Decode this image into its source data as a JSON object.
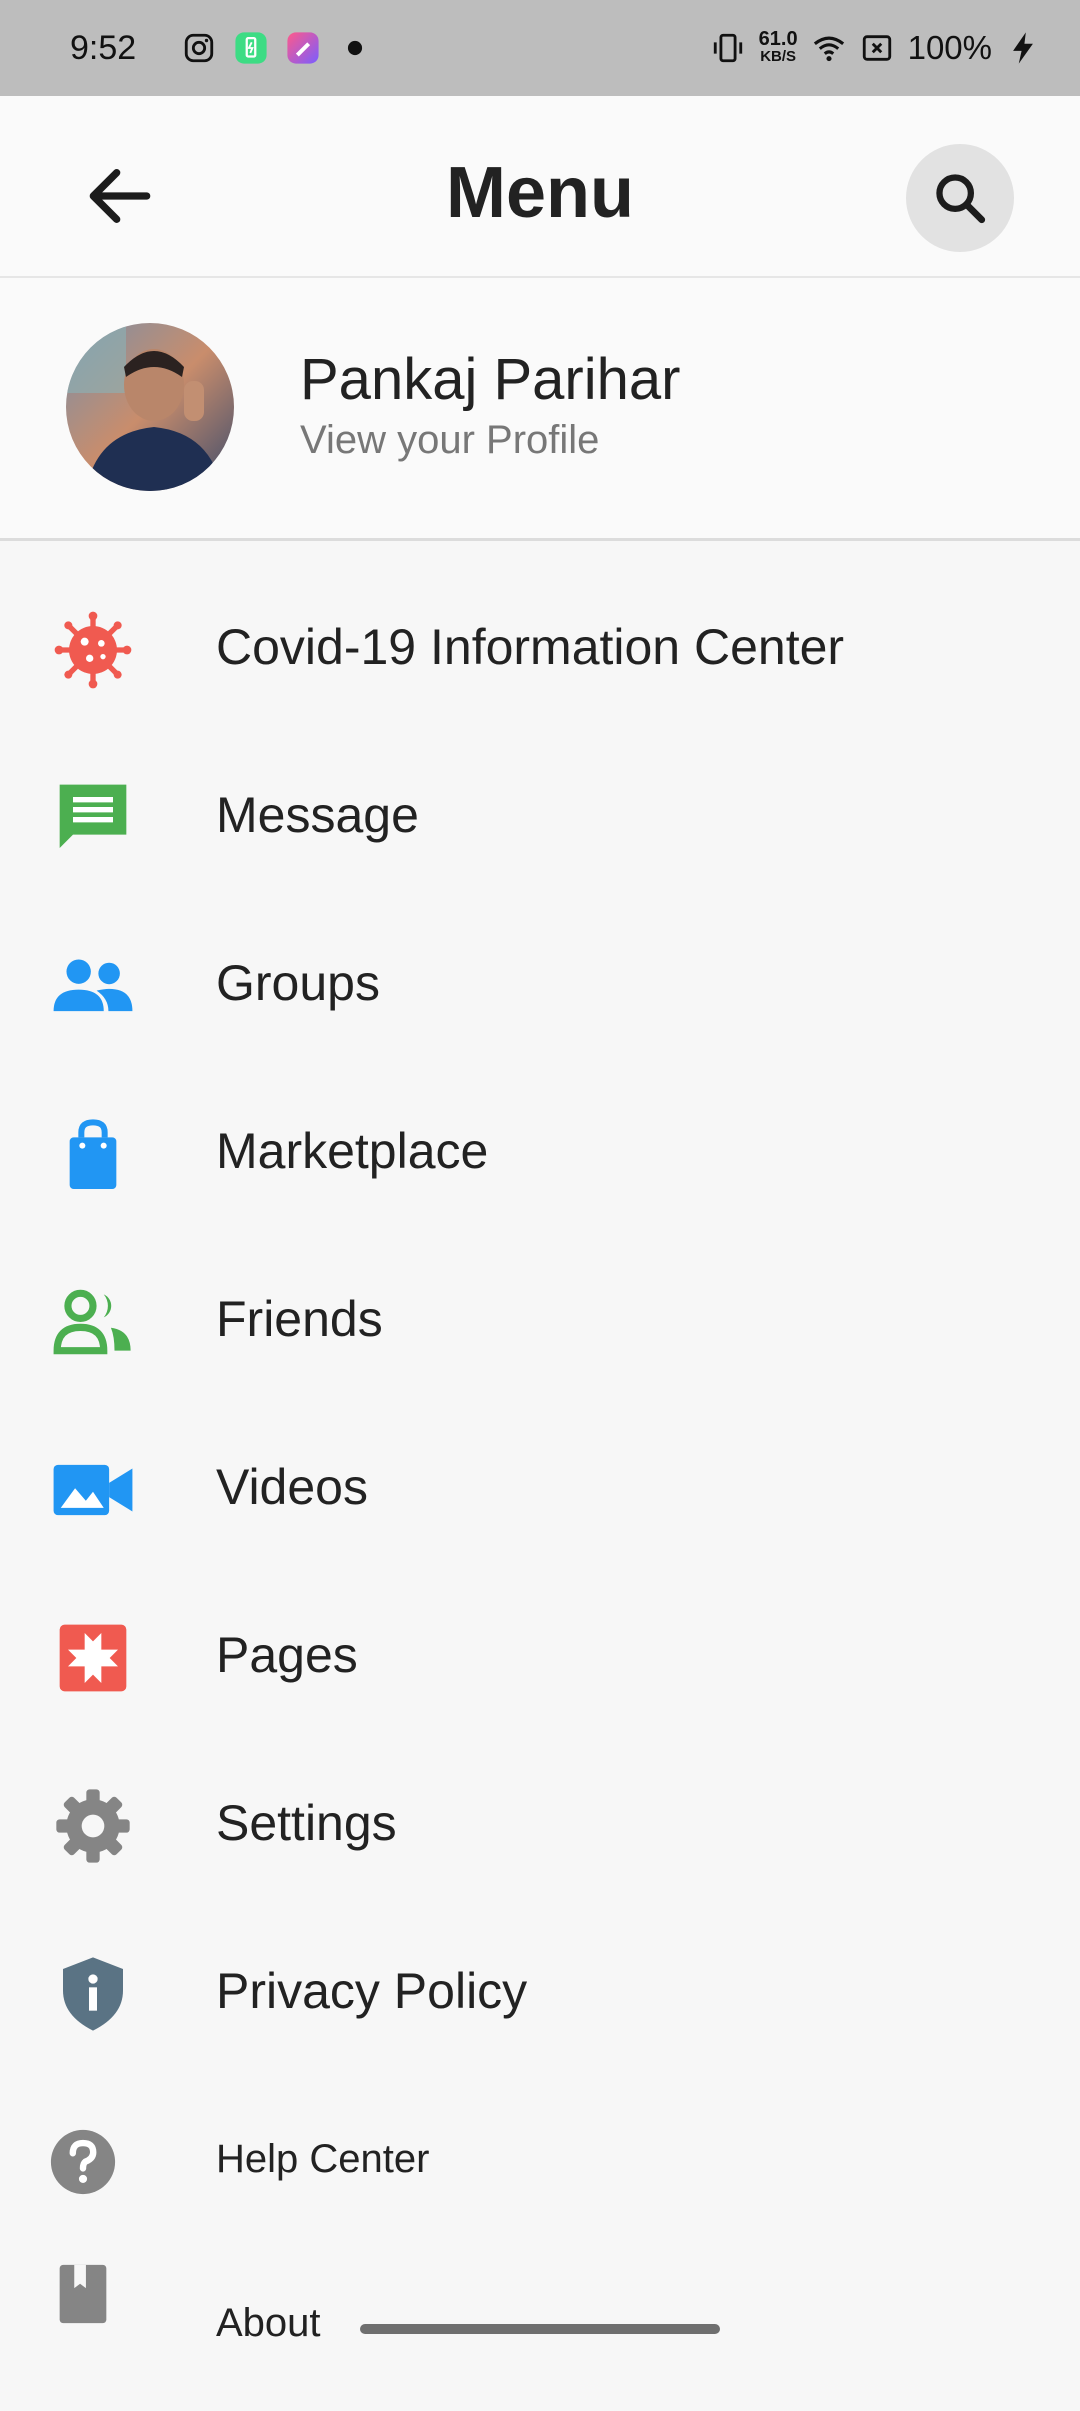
{
  "status_bar": {
    "time": "9:52",
    "net_speed_value": "61.0",
    "net_speed_unit": "KB/S",
    "battery": "100%"
  },
  "header": {
    "title": "Menu",
    "back_icon": "arrow-left-icon",
    "search_icon": "search-icon"
  },
  "profile": {
    "name": "Pankaj Parihar",
    "subtitle": "View your Profile"
  },
  "menu": {
    "items": [
      {
        "label": "Covid-19 Information Center",
        "icon": "virus-icon",
        "color": "#f05a50"
      },
      {
        "label": "Message",
        "icon": "message-icon",
        "color": "#4caf50"
      },
      {
        "label": "Groups",
        "icon": "groups-icon",
        "color": "#2196f3"
      },
      {
        "label": "Marketplace",
        "icon": "shopping-bag-icon",
        "color": "#2196f3"
      },
      {
        "label": "Friends",
        "icon": "friends-icon",
        "color": "#4caf50"
      },
      {
        "label": "Videos",
        "icon": "video-camera-icon",
        "color": "#2196f3"
      },
      {
        "label": "Pages",
        "icon": "pages-flag-icon",
        "color": "#f05a50"
      },
      {
        "label": "Settings",
        "icon": "gear-icon",
        "color": "#858585"
      },
      {
        "label": "Privacy Policy",
        "icon": "shield-info-icon",
        "color": "#5a7384"
      },
      {
        "label": "Help Center",
        "icon": "help-icon",
        "color": "#858585"
      },
      {
        "label": "About",
        "icon": "book-icon",
        "color": "#858585"
      }
    ]
  }
}
